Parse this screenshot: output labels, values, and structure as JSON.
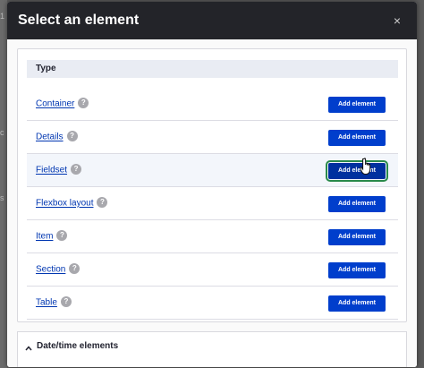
{
  "dialog": {
    "title": "Select an element",
    "close_symbol": "×"
  },
  "backdrop": {
    "fragments": [
      "1",
      "c",
      "s"
    ]
  },
  "table": {
    "header": "Type",
    "rows": [
      {
        "name": "Container",
        "help": "?",
        "button": "Add element"
      },
      {
        "name": "Details",
        "help": "?",
        "button": "Add element"
      },
      {
        "name": "Fieldset",
        "help": "?",
        "button": "Add element"
      },
      {
        "name": "Flexbox layout",
        "help": "?",
        "button": "Add element"
      },
      {
        "name": "Item",
        "help": "?",
        "button": "Add element"
      },
      {
        "name": "Section",
        "help": "?",
        "button": "Add element"
      },
      {
        "name": "Table",
        "help": "?",
        "button": "Add element"
      }
    ]
  },
  "collapsed_section": {
    "label": "Date/time elements"
  },
  "colors": {
    "titlebar": "#232429",
    "button": "#003ecc",
    "link": "#0036b1",
    "focus_outline": "#2a8a4b"
  },
  "icons": [
    "close-icon",
    "help-icon",
    "chevron-up-icon",
    "hand-cursor-icon"
  ]
}
